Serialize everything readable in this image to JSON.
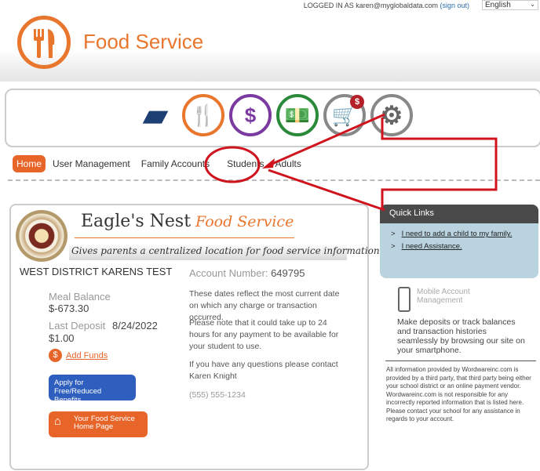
{
  "header": {
    "logged_in_prefix": "LOGGED IN AS",
    "user_email": "karen@myglobaldata.com",
    "sign_out": "(sign out)",
    "language": "English",
    "title": "Food Service"
  },
  "app_icons": [
    {
      "name": "wallet",
      "color": "#1d3f73"
    },
    {
      "name": "food-service",
      "color": "#e8762d"
    },
    {
      "name": "tuition",
      "color": "#7b3aa0"
    },
    {
      "name": "payments",
      "color": "#2a8a3a"
    },
    {
      "name": "store",
      "color": "#777777",
      "badge": "$"
    },
    {
      "name": "settings",
      "color": "#777777"
    }
  ],
  "nav": [
    {
      "label": "Home",
      "active": true
    },
    {
      "label": "User Management"
    },
    {
      "label": "Family Accounts"
    },
    {
      "label": "Students"
    },
    {
      "label": "Adults"
    }
  ],
  "banner": {
    "name": "Eagle's Nest",
    "highlight": "Food Service",
    "tagline": "Gives parents a centralized location for food service information"
  },
  "account": {
    "district": "WEST DISTRICT KARENS TEST",
    "account_label": "Account Number:",
    "account_number": "649795",
    "meal_balance_label": "Meal Balance",
    "meal_balance": "$-673.30",
    "last_deposit_label": "Last Deposit",
    "last_deposit_date": "8/24/2022",
    "last_deposit_amount": "$1.00",
    "add_funds": "Add Funds",
    "apply_button": "Apply for Free/Reduced Benefits",
    "home_button": "Your Food Service Home Page"
  },
  "info": {
    "p1": "These dates reflect the most current date on which any charge or transaction occurred.",
    "p2": "Please note that it could take up to 24 hours for any payment to be available for your student to use.",
    "p3": "If you have any questions please contact Karen Knight",
    "phone": "(555) 555-1234"
  },
  "quick_links": {
    "title": "Quick Links",
    "items": [
      "I need to add a child to my family.",
      "I need Assistance."
    ]
  },
  "mobile": {
    "title": "Mobile Account Management",
    "description": "Make deposits or track balances and transaction histories seamlessly by browsing our site on your smartphone."
  },
  "disclaimer": "All information provided by Wordwareinc.com is provided by a third party, that third party being either your school district or an online payment vendor. Wordwareinc.com is not responsible for any incorrectly reported information that is listed here. Please contact your school for any assistance in regards to your account.",
  "annotation_color": "#d0141e"
}
